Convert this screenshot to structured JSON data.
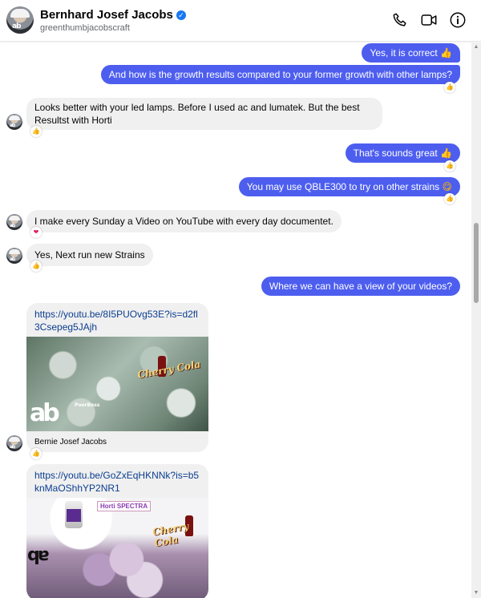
{
  "header": {
    "name": "Bernhard Josef Jacobs",
    "handle": "greenthumbjacobscraft"
  },
  "messages": {
    "m1": "Yes, it is correct",
    "m2": "And how is the growth results compared to your former growth with other lamps?",
    "m3": "Looks better with your led lamps. Before I used ac and lumatek. But the best Resultst with Horti",
    "m4": "That's sounds great",
    "m5": "You may use QBLE300 to try on other strains",
    "m6": "I make every Sunday a Video on YouTube with every day documentet.",
    "m7": "Yes, Next run new Strains",
    "m8": "Where we can have a view of your videos?"
  },
  "links": [
    {
      "url": "https://youtu.be/8I5PUOvg53E?is=d2fl3Csepeg5JAjh",
      "caption": "Bernie Josef Jacobs",
      "brand": "Cherry Cola",
      "overlay": "PoorBoss"
    },
    {
      "url": "https://youtu.be/GoZxEqHKNNk?is=b5knMaOShhYP2NR1",
      "brand": "Cherry Cola",
      "overlay": "Horti SPECTRA"
    }
  ],
  "reactions": {
    "thumbs": "👍",
    "heart": "❤"
  },
  "colors": {
    "outgoing": "#4d5eef",
    "incoming": "#f0f0f0",
    "link": "#0a3d8f",
    "verified": "#1877f2"
  },
  "icons": [
    "phone-icon",
    "video-call-icon",
    "info-icon",
    "verified-badge-icon"
  ]
}
